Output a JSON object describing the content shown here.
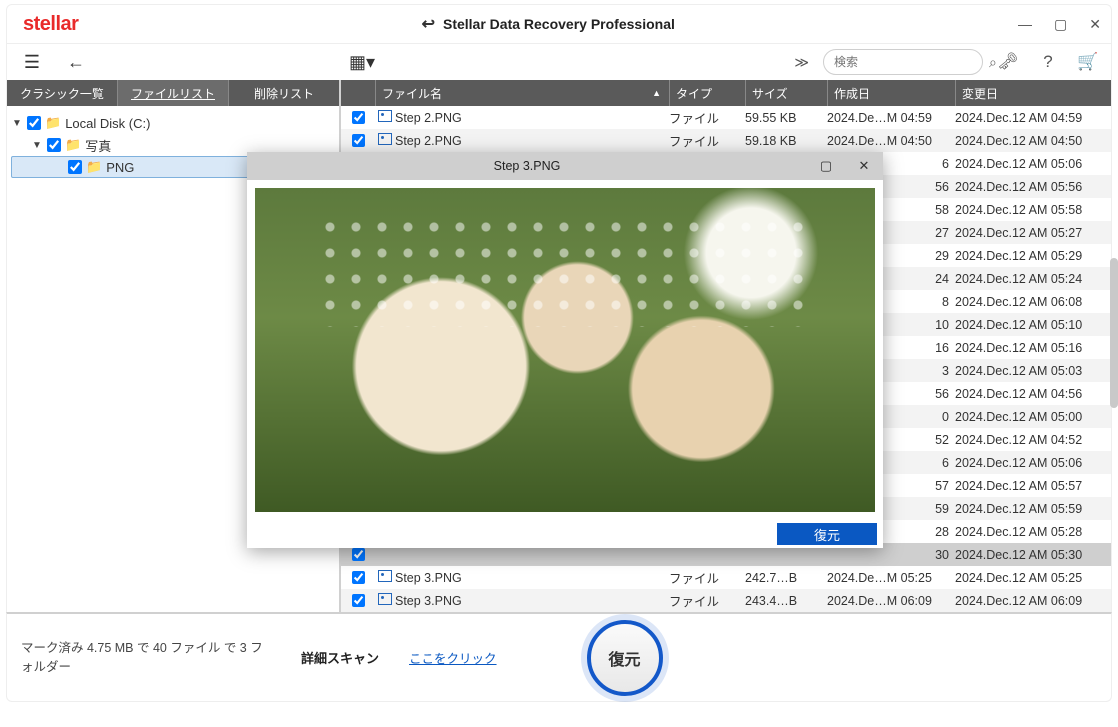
{
  "title": "Stellar Data Recovery Professional",
  "logo": "stellar",
  "search": {
    "placeholder": "検索"
  },
  "tabs": {
    "classic": "クラシック一覧",
    "filelist": "ファイルリスト",
    "deleted": "削除リスト"
  },
  "tree": {
    "root": "Local Disk (C:)",
    "child1": "写真",
    "child2": "PNG"
  },
  "columns": {
    "name": "ファイル名",
    "type": "タイプ",
    "size": "サイズ",
    "created": "作成日",
    "modified": "変更日"
  },
  "preview": {
    "title": "Step 3.PNG",
    "recover": "復元"
  },
  "files": [
    {
      "name": "Step 2.PNG",
      "type": "ファイル",
      "size": "59.55 KB",
      "created": "2024.De…M 04:59",
      "modified": "2024.Dec.12 AM 04:59"
    },
    {
      "name": "Step 2.PNG",
      "type": "ファイル",
      "size": "59.18 KB",
      "created": "2024.De…M 04:50",
      "modified": "2024.Dec.12 AM 04:50"
    },
    {
      "name": "",
      "type": "",
      "size": "",
      "created": "6",
      "modified": "2024.Dec.12 AM 05:06"
    },
    {
      "name": "",
      "type": "",
      "size": "",
      "created": "56",
      "modified": "2024.Dec.12 AM 05:56"
    },
    {
      "name": "",
      "type": "",
      "size": "",
      "created": "58",
      "modified": "2024.Dec.12 AM 05:58"
    },
    {
      "name": "",
      "type": "",
      "size": "",
      "created": "27",
      "modified": "2024.Dec.12 AM 05:27"
    },
    {
      "name": "",
      "type": "",
      "size": "",
      "created": "29",
      "modified": "2024.Dec.12 AM 05:29"
    },
    {
      "name": "",
      "type": "",
      "size": "",
      "created": "24",
      "modified": "2024.Dec.12 AM 05:24"
    },
    {
      "name": "",
      "type": "",
      "size": "",
      "created": "8",
      "modified": "2024.Dec.12 AM 06:08"
    },
    {
      "name": "",
      "type": "",
      "size": "",
      "created": "10",
      "modified": "2024.Dec.12 AM 05:10"
    },
    {
      "name": "",
      "type": "",
      "size": "",
      "created": "16",
      "modified": "2024.Dec.12 AM 05:16"
    },
    {
      "name": "",
      "type": "",
      "size": "",
      "created": "3",
      "modified": "2024.Dec.12 AM 05:03"
    },
    {
      "name": "",
      "type": "",
      "size": "",
      "created": "56",
      "modified": "2024.Dec.12 AM 04:56"
    },
    {
      "name": "",
      "type": "",
      "size": "",
      "created": "0",
      "modified": "2024.Dec.12 AM 05:00"
    },
    {
      "name": "",
      "type": "",
      "size": "",
      "created": "52",
      "modified": "2024.Dec.12 AM 04:52"
    },
    {
      "name": "",
      "type": "",
      "size": "",
      "created": "6",
      "modified": "2024.Dec.12 AM 05:06"
    },
    {
      "name": "",
      "type": "",
      "size": "",
      "created": "57",
      "modified": "2024.Dec.12 AM 05:57"
    },
    {
      "name": "",
      "type": "",
      "size": "",
      "created": "59",
      "modified": "2024.Dec.12 AM 05:59"
    },
    {
      "name": "",
      "type": "",
      "size": "",
      "created": "28",
      "modified": "2024.Dec.12 AM 05:28"
    },
    {
      "name": "",
      "type": "",
      "size": "",
      "created": "30",
      "modified": "2024.Dec.12 AM 05:30",
      "sel": true
    },
    {
      "name": "Step 3.PNG",
      "type": "ファイル",
      "size": "242.7…B",
      "created": "2024.De…M 05:25",
      "modified": "2024.Dec.12 AM 05:25"
    },
    {
      "name": "Step 3.PNG",
      "type": "ファイル",
      "size": "243.4…B",
      "created": "2024.De…M 06:09",
      "modified": "2024.Dec.12 AM 06:09"
    }
  ],
  "status": "マーク済み 4.75 MB で 40 ファイル で 3 フォルダー",
  "detail_scan_label": "詳細スキャン",
  "detail_scan_link": "ここをクリック",
  "recover_button": "復元"
}
